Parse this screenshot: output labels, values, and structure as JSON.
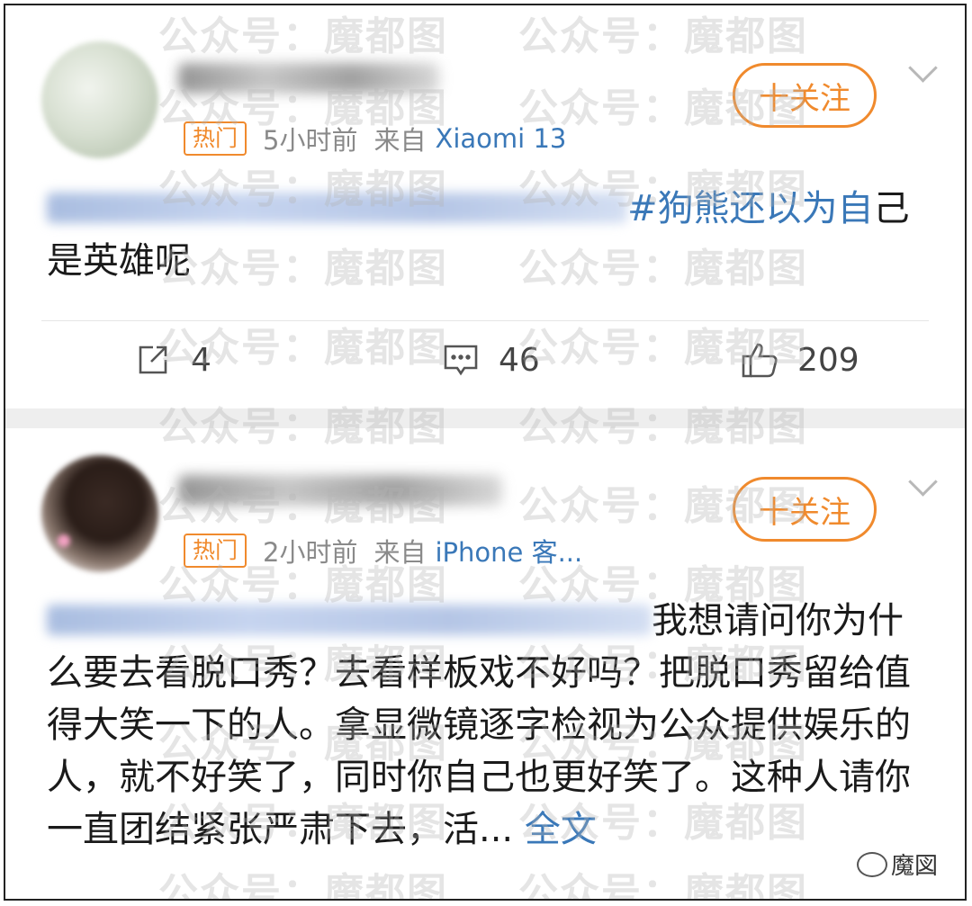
{
  "posts": [
    {
      "meta": {
        "hot_badge": "热门",
        "time": "5小时前",
        "source_prefix": "来自",
        "device": "Xiaomi 13"
      },
      "follow_label": "十关注",
      "content": {
        "hashtag": "#狗熊还以为自",
        "rest": "己是英雄呢"
      },
      "actions": {
        "reposts": "4",
        "comments": "46",
        "likes": "209"
      }
    },
    {
      "meta": {
        "hot_badge": "热门",
        "time": "2小时前",
        "source_prefix": "来自",
        "device": "iPhone 客..."
      },
      "follow_label": "十关注",
      "content": {
        "first": "我想请问你为",
        "body": "什么要去看脱口秀？去看样板戏不好吗？把脱口秀留给值得大笑一下的人。拿显微镜逐字检视为公众提供娱乐的人，就不好笑了，同时你自己也更好笑了。这种人请你一直团结紧张严肃下去，活...",
        "more": "全文"
      }
    }
  ],
  "watermark_text": "公众号：魔都图",
  "brand_logo_text": "魔図",
  "colors": {
    "accent_orange": "#f08a2d",
    "link_blue": "#3a78b8"
  },
  "icons": [
    "share-icon",
    "comment-icon",
    "like-icon",
    "chevron-down-icon",
    "wechat-icon"
  ]
}
